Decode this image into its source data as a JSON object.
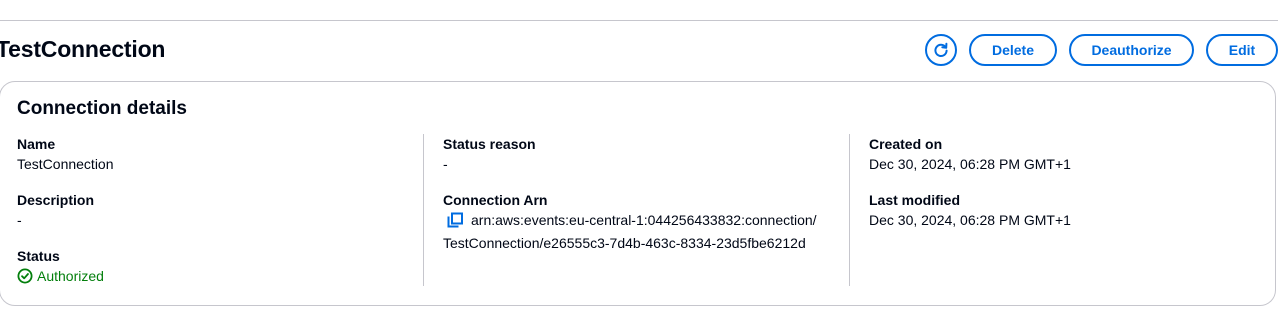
{
  "header": {
    "title": "TestConnection",
    "buttons": {
      "delete": "Delete",
      "deauthorize": "Deauthorize",
      "edit": "Edit"
    }
  },
  "details": {
    "heading": "Connection details",
    "name_label": "Name",
    "name_value": "TestConnection",
    "description_label": "Description",
    "description_value": "-",
    "status_label": "Status",
    "status_value": "Authorized",
    "status_reason_label": "Status reason",
    "status_reason_value": "-",
    "arn_label": "Connection Arn",
    "arn_value": "arn:aws:events:eu-central-1:044256433832:connection/TestConnection/e26555c3-7d4b-463c-8334-23d5fbe6212d",
    "created_label": "Created on",
    "created_value": "Dec 30, 2024, 06:28 PM GMT+1",
    "modified_label": "Last modified",
    "modified_value": "Dec 30, 2024, 06:28 PM GMT+1"
  },
  "icons": {
    "refresh": "refresh-icon",
    "status": "check-circle-icon",
    "copy": "copy-icon"
  },
  "colors": {
    "accent": "#006ce0",
    "success": "#037f0c",
    "text": "#000716",
    "border": "#c6c6cd"
  }
}
